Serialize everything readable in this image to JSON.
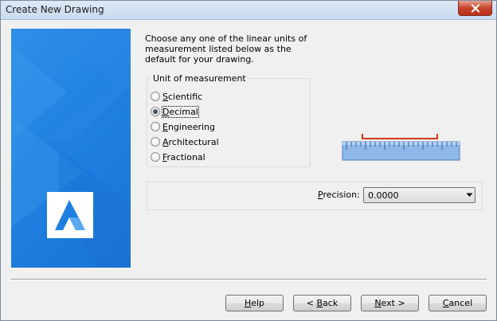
{
  "window": {
    "title": "Create New Drawing"
  },
  "intro": {
    "text": "Choose any one of the linear units of measurement listed below as the default for your drawing."
  },
  "units": {
    "legend": "Unit of measurement",
    "options": [
      {
        "label": "Scientific",
        "accel": "S",
        "rest": "cientific",
        "checked": false
      },
      {
        "label": "Decimal",
        "accel": "D",
        "rest": "ecimal",
        "checked": true
      },
      {
        "label": "Engineering",
        "accel": "E",
        "rest": "ngineering",
        "checked": false
      },
      {
        "label": "Architectural",
        "accel": "A",
        "rest": "rchitectural",
        "checked": false
      },
      {
        "label": "Fractional",
        "accel": "F",
        "rest": "ractional",
        "checked": false
      }
    ]
  },
  "precision": {
    "label_accel": "P",
    "label_rest": "recision:",
    "value": "0.0000"
  },
  "buttons": {
    "help_accel": "H",
    "help_rest": "elp",
    "back_prefix": "< ",
    "back_accel": "B",
    "back_rest": "ack",
    "next_accel": "N",
    "next_rest": "ext >",
    "cancel_accel": "C",
    "cancel_rest": "ancel"
  },
  "colors": {
    "banner_blue": "#1f7fe0",
    "ruler_blue": "#8fb8e8",
    "ruler_marker": "#d0391c"
  },
  "icons": {
    "close": "close-icon",
    "logo": "app-logo-icon",
    "ruler": "ruler-icon",
    "dropdown": "chevron-down-icon"
  }
}
